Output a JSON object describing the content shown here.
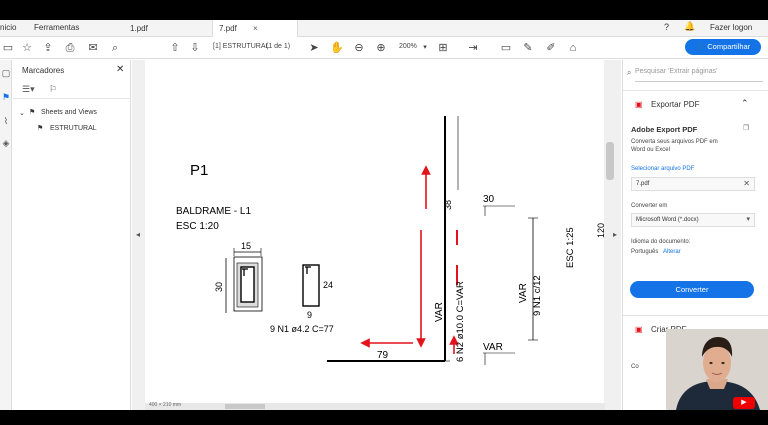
{
  "menu": {
    "home": "nicio",
    "tools": "Ferramentas"
  },
  "tabs": [
    {
      "label": "1.pdf"
    },
    {
      "label": "7.pdf"
    }
  ],
  "header": {
    "login": "Fazer logon",
    "share": "Compartilhar"
  },
  "toolbar": {
    "page_label": "[1] ESTRUTURAL",
    "page_count": "(1 de 1)",
    "zoom": "200%"
  },
  "bookmarks": {
    "title": "Marcadores",
    "tree": [
      {
        "label": "Sheets and Views"
      },
      {
        "label": "ESTRUTURAL"
      }
    ]
  },
  "drawing": {
    "title": "P1",
    "section_title": "BALDRAME - L1",
    "section_scale": "ESC 1:20",
    "beam_width": "15",
    "beam_height": "30",
    "stirrup_height": "24",
    "stirrup_width": "9",
    "stirrup_spec": "9 N1 ø4.2  C=77",
    "dim_38": "38",
    "dim_30": "30",
    "var_top": "VAR",
    "var_bottom": "VAR",
    "bar_spec": "6 N2 ø10.0  C=VAR",
    "var_vertical_1": "VAR",
    "var_vertical_2": "VAR",
    "stirrups_vertical": "9 N1 c/12",
    "elevation_scale": "ESC 1:25",
    "dim_79": "79",
    "edge_number": "120"
  },
  "right_panel": {
    "search_placeholder": "Pesquisar 'Extrair páginas'",
    "export_section": "Exportar PDF",
    "export_title": "Adobe Export PDF",
    "export_desc_1": "Converta seus arquivos PDF em",
    "export_desc_2": "Word ou Excel",
    "select_file_link": "Selecionar arquivo PDF",
    "file_name": "7.pdf",
    "convert_to_label": "Converter em",
    "convert_to_value": "Microsoft Word (*.docx)",
    "doc_language_label": "Idioma do documento:",
    "doc_language_value": "Português",
    "change_link": "Alterar",
    "convert_button": "Converter",
    "create_pdf": "Criar PDF",
    "partial_text": "Co"
  },
  "webcam": {
    "badge": "INSCREVA"
  },
  "hscroll": {
    "label": "400 × 210 mm"
  },
  "colors": {
    "accent": "#1473e6",
    "annotation_red": "#e3131b"
  }
}
